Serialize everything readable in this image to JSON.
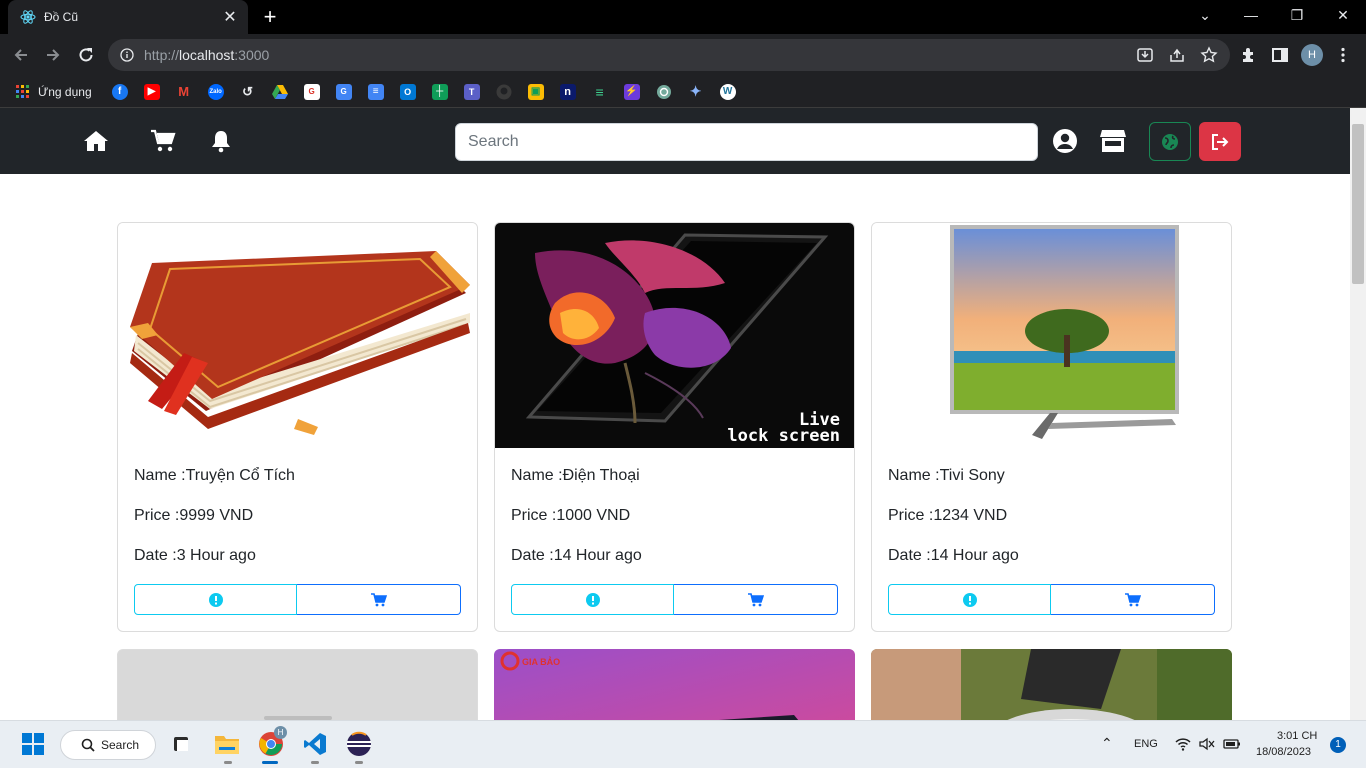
{
  "browser": {
    "tab_title": "Đồ Cũ",
    "url_prefix": "http://",
    "url_host": "localhost",
    "url_port": ":3000",
    "profile_initial": "H",
    "bookmark_folder_label": "Ứng dụng"
  },
  "navbar": {
    "search_placeholder": "Search"
  },
  "labels": {
    "name_prefix": "Name :",
    "price_prefix": "Price :",
    "date_prefix": "Date :"
  },
  "products": [
    {
      "name": "Truyện Cổ Tích",
      "price": "9999 VND",
      "date": "3 Hour ago",
      "image": "book"
    },
    {
      "name": "Điện Thoại",
      "price": "1000 VND",
      "date": "14 Hour ago",
      "image": "phone",
      "image_caption_1": "Live",
      "image_caption_2": "lock screen"
    },
    {
      "name": "Tivi Sony",
      "price": "1234 VND",
      "date": "14 Hour ago",
      "image": "tv"
    }
  ],
  "second_row_preview": {
    "middle_logo_text": "GIA BẢO"
  },
  "taskbar": {
    "search_label": "Search",
    "language": "ENG",
    "time": "3:01 CH",
    "date": "18/08/2023",
    "notification_count": "1",
    "chrome_badge": "H"
  },
  "colors": {
    "navbar_bg": "#212529",
    "info": "#0dcaf0",
    "primary": "#0d6efd",
    "danger": "#dc3545",
    "success": "#198754"
  }
}
